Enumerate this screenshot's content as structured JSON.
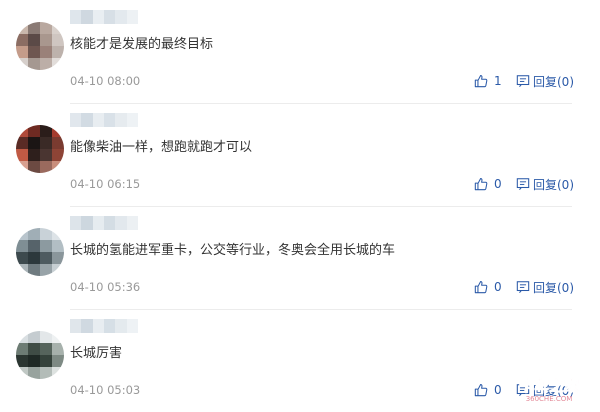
{
  "comments": [
    {
      "text": "核能才是发展的最终目标",
      "timestamp": "04-10 08:00",
      "like_count": "1",
      "reply_label": "回复(0)",
      "avatar_colors": [
        "#c9b7ac",
        "#8a7a74",
        "#b9a89f",
        "#d8d0cb",
        "#8b6d63",
        "#5b4a47",
        "#a9978e",
        "#cfc6c1",
        "#c49c8a",
        "#6e5650",
        "#9a8179",
        "#bdb2ac",
        "#d6cfcb",
        "#a59891",
        "#bcaea7",
        "#e2ddda"
      ],
      "name_colors": [
        "#dfe6ec",
        "#cfd8e0",
        "#e9eef2",
        "#d7dfe6",
        "#e3e9ee",
        "#edf1f4"
      ]
    },
    {
      "text": "能像柴油一样，想跑就跑才可以",
      "timestamp": "04-10 06:15",
      "like_count": "0",
      "reply_label": "回复(0)",
      "avatar_colors": [
        "#b04a3a",
        "#6e2a22",
        "#2b1d1a",
        "#a53c2e",
        "#5a2b25",
        "#1b1514",
        "#3a2a26",
        "#7a3b30",
        "#c05a44",
        "#2e1f1c",
        "#4a3531",
        "#8e4436",
        "#d8a090",
        "#6c4a42",
        "#9a6a5e",
        "#c98e7c"
      ],
      "name_colors": [
        "#e1e7ed",
        "#d2dbe3",
        "#e8edf1",
        "#d9e1e8",
        "#e6ebef",
        "#eef2f5"
      ]
    },
    {
      "text": "长城的氢能进军重卡，公交等行业，冬奥会全用长城的车",
      "timestamp": "04-10 05:36",
      "like_count": "0",
      "reply_label": "回复(0)",
      "avatar_colors": [
        "#b8c4cc",
        "#a0aeb6",
        "#c9d2d8",
        "#dde3e7",
        "#7f8e94",
        "#56636a",
        "#8c9aa0",
        "#b2bec4",
        "#3d4a4e",
        "#2c383c",
        "#4e5b60",
        "#8a969b",
        "#aab4b8",
        "#6f7b80",
        "#98a3a8",
        "#c7cfd3"
      ],
      "name_colors": [
        "#dde4ea",
        "#cdd7df",
        "#e6ecf0",
        "#d4dde4",
        "#e2e8ed",
        "#ecf0f3"
      ]
    },
    {
      "text": "长城厉害",
      "timestamp": "04-10 05:03",
      "like_count": "0",
      "reply_label": "回复(0)",
      "avatar_colors": [
        "#d9dfe2",
        "#c5ccd0",
        "#e3e7e9",
        "#eef1f2",
        "#6d7c74",
        "#3f4c45",
        "#56645c",
        "#a7b1ac",
        "#2b3631",
        "#1f2925",
        "#35423b",
        "#7e8a84",
        "#c0c8c4",
        "#98a39e",
        "#b3bcb8",
        "#dde2e0"
      ],
      "name_colors": [
        "#e0e6eb",
        "#d0d9e1",
        "#e8edf1",
        "#d6dfe6",
        "#e4eaee",
        "#eef2f5"
      ]
    }
  ],
  "watermark": {
    "text": "卡车之家",
    "subtext": "360CHE.COM",
    "color": "#c8102e"
  },
  "colors": {
    "link": "#2b5aa8",
    "divider": "#ececec",
    "timestamp": "#999999"
  }
}
